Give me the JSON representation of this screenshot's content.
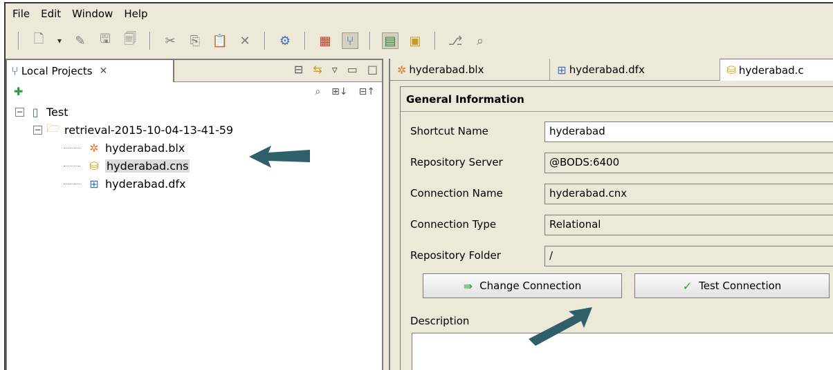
{
  "menu": [
    "File",
    "Edit",
    "Window",
    "Help"
  ],
  "left_panel": {
    "tab_label": "Local Projects",
    "tab_close": "✕",
    "tree": {
      "project": "Test",
      "folder": "retrieval-2015-10-04-13-41-59",
      "files": [
        "hyderabad.blx",
        "hyderabad.cns",
        "hyderabad.dfx"
      ]
    }
  },
  "editor_tabs": [
    "hyderabad.blx",
    "hyderabad.dfx",
    "hyderabad.c"
  ],
  "general_info": {
    "title": "General Information",
    "fields": [
      {
        "label": "Shortcut Name",
        "value": "hyderabad"
      },
      {
        "label": "Repository Server",
        "value": "@BODS:6400"
      },
      {
        "label": "Connection Name",
        "value": "hyderabad.cnx"
      },
      {
        "label": "Connection Type",
        "value": "Relational"
      },
      {
        "label": "Repository Folder",
        "value": "/"
      }
    ],
    "change_connection": "Change Connection",
    "test_connection": "Test Connection",
    "description_label": "Description"
  },
  "colors": {
    "annotation_arrow": "#2f5f68",
    "selected": "#dcdcdc"
  }
}
